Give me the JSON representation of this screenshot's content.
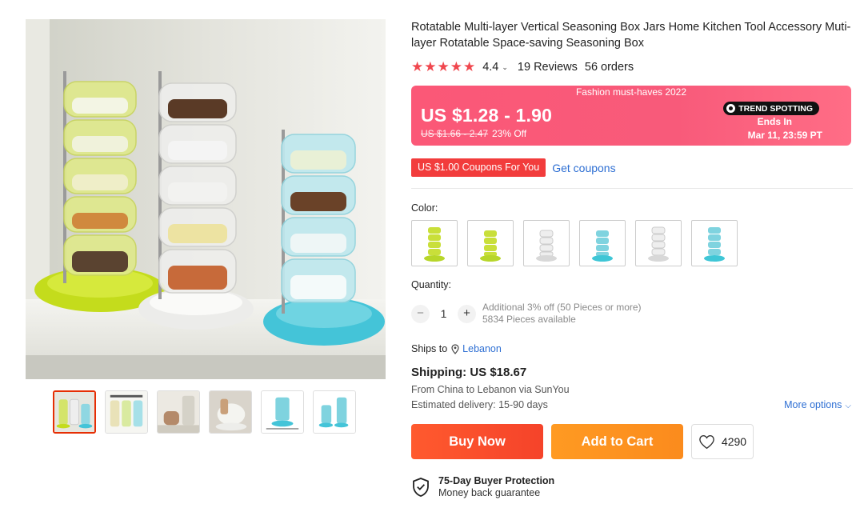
{
  "product": {
    "title": "Rotatable Multi-layer Vertical Seasoning Box Jars Home Kitchen Tool Accessory Muti-layer Rotatable Space-saving Seasoning Box",
    "rating": "4.4",
    "stars": "★★★★★",
    "reviews": "19 Reviews",
    "orders": "56 orders"
  },
  "gallery": {
    "main_image": "seasoning-tower-photo",
    "thumbnails": [
      "thumb-all-colors",
      "thumb-size-chart",
      "thumb-in-use",
      "thumb-closeup",
      "thumb-blue-dimensions",
      "thumb-blue-two-sizes"
    ]
  },
  "price_banner": {
    "caption": "Fashion must-haves 2022",
    "price": "US $1.28 - 1.90",
    "old_price": "US $1.66 - 2.47",
    "discount": "23% Off",
    "trend_label": "TREND SPOTTING",
    "ends_label": "Ends In",
    "ends_date": "Mar 11, 23:59 PT",
    "colors": {
      "banner": "#fb5877",
      "trend_bg": "#111111"
    }
  },
  "coupon": {
    "tag": "US $1.00 Coupons For You",
    "link": "Get coupons"
  },
  "color_picker": {
    "label": "Color:",
    "options": [
      {
        "name": "green-5-tier",
        "color": "#b7d62a"
      },
      {
        "name": "green-4-tier",
        "color": "#b7d62a"
      },
      {
        "name": "white-4-tier",
        "color": "#d8d8d8"
      },
      {
        "name": "blue-4-tier",
        "color": "#3fc6d6"
      },
      {
        "name": "white-5-tier",
        "color": "#d8d8d8"
      },
      {
        "name": "blue-5-tier",
        "color": "#3fc6d6"
      }
    ]
  },
  "quantity": {
    "label": "Quantity:",
    "minus": "−",
    "value": "1",
    "plus": "+",
    "discount_note": "Additional 3% off (50 Pieces or more)",
    "available": "5834 Pieces available"
  },
  "shipping": {
    "ships_to_label": "Ships to",
    "destination": "Lebanon",
    "cost": "Shipping: US $18.67",
    "route": "From China to Lebanon via SunYou",
    "estimated": "Estimated delivery: 15-90 days",
    "more_options": "More options",
    "more_icon": "⌵"
  },
  "actions": {
    "buy_now": "Buy Now",
    "add_to_cart": "Add to Cart",
    "wishlist_count": "4290"
  },
  "protection": {
    "title": "75-Day Buyer Protection",
    "subtitle": "Money back guarantee"
  }
}
